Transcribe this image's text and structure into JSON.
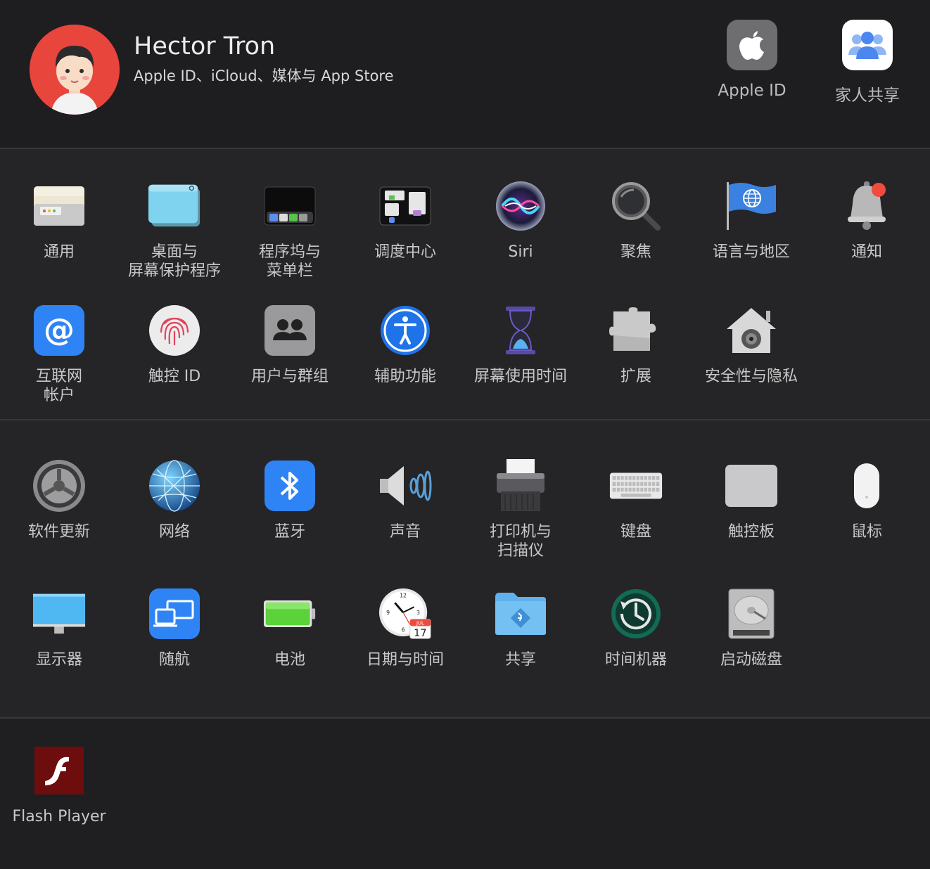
{
  "user": {
    "name": "Hector Tron",
    "subtitle": "Apple ID、iCloud、媒体与 App Store"
  },
  "top_items": [
    {
      "label": "Apple ID",
      "icon": "apple-logo-icon"
    },
    {
      "label": "家人共享",
      "icon": "family-sharing-icon"
    }
  ],
  "section1": {
    "row1": [
      {
        "label": "通用",
        "icon": "general-icon"
      },
      {
        "label": "桌面与\n屏幕保护程序",
        "icon": "desktop-screensaver-icon"
      },
      {
        "label": "程序坞与\n菜单栏",
        "icon": "dock-menubar-icon"
      },
      {
        "label": "调度中心",
        "icon": "mission-control-icon"
      },
      {
        "label": "Siri",
        "icon": "siri-icon"
      },
      {
        "label": "聚焦",
        "icon": "spotlight-icon"
      },
      {
        "label": "语言与地区",
        "icon": "language-region-icon"
      },
      {
        "label": "通知",
        "icon": "notifications-icon"
      }
    ],
    "row2": [
      {
        "label": "互联网\n帐户",
        "icon": "internet-accounts-icon"
      },
      {
        "label": "触控 ID",
        "icon": "touch-id-icon"
      },
      {
        "label": "用户与群组",
        "icon": "users-groups-icon"
      },
      {
        "label": "辅助功能",
        "icon": "accessibility-icon"
      },
      {
        "label": "屏幕使用时间",
        "icon": "screen-time-icon"
      },
      {
        "label": "扩展",
        "icon": "extensions-icon"
      },
      {
        "label": "安全性与隐私",
        "icon": "security-privacy-icon"
      }
    ]
  },
  "section2": {
    "row1": [
      {
        "label": "软件更新",
        "icon": "software-update-icon"
      },
      {
        "label": "网络",
        "icon": "network-icon"
      },
      {
        "label": "蓝牙",
        "icon": "bluetooth-icon"
      },
      {
        "label": "声音",
        "icon": "sound-icon"
      },
      {
        "label": "打印机与\n扫描仪",
        "icon": "printers-scanners-icon"
      },
      {
        "label": "键盘",
        "icon": "keyboard-icon"
      },
      {
        "label": "触控板",
        "icon": "trackpad-icon"
      },
      {
        "label": "鼠标",
        "icon": "mouse-icon"
      }
    ],
    "row2": [
      {
        "label": "显示器",
        "icon": "displays-icon"
      },
      {
        "label": "随航",
        "icon": "sidecar-icon"
      },
      {
        "label": "电池",
        "icon": "battery-icon"
      },
      {
        "label": "日期与时间",
        "icon": "date-time-icon"
      },
      {
        "label": "共享",
        "icon": "sharing-icon"
      },
      {
        "label": "时间机器",
        "icon": "time-machine-icon"
      },
      {
        "label": "启动磁盘",
        "icon": "startup-disk-icon"
      }
    ]
  },
  "section3": {
    "row1": [
      {
        "label": "Flash Player",
        "icon": "flash-player-icon"
      }
    ]
  },
  "calendar": {
    "month": "JUL",
    "day": "17"
  },
  "colors": {
    "background": "#1f1f21",
    "section_bg": "#252527",
    "divider": "#39393b",
    "label": "#c8c8c8",
    "accent_blue": "#2f7cf6",
    "avatar_red": "#e8453c"
  }
}
